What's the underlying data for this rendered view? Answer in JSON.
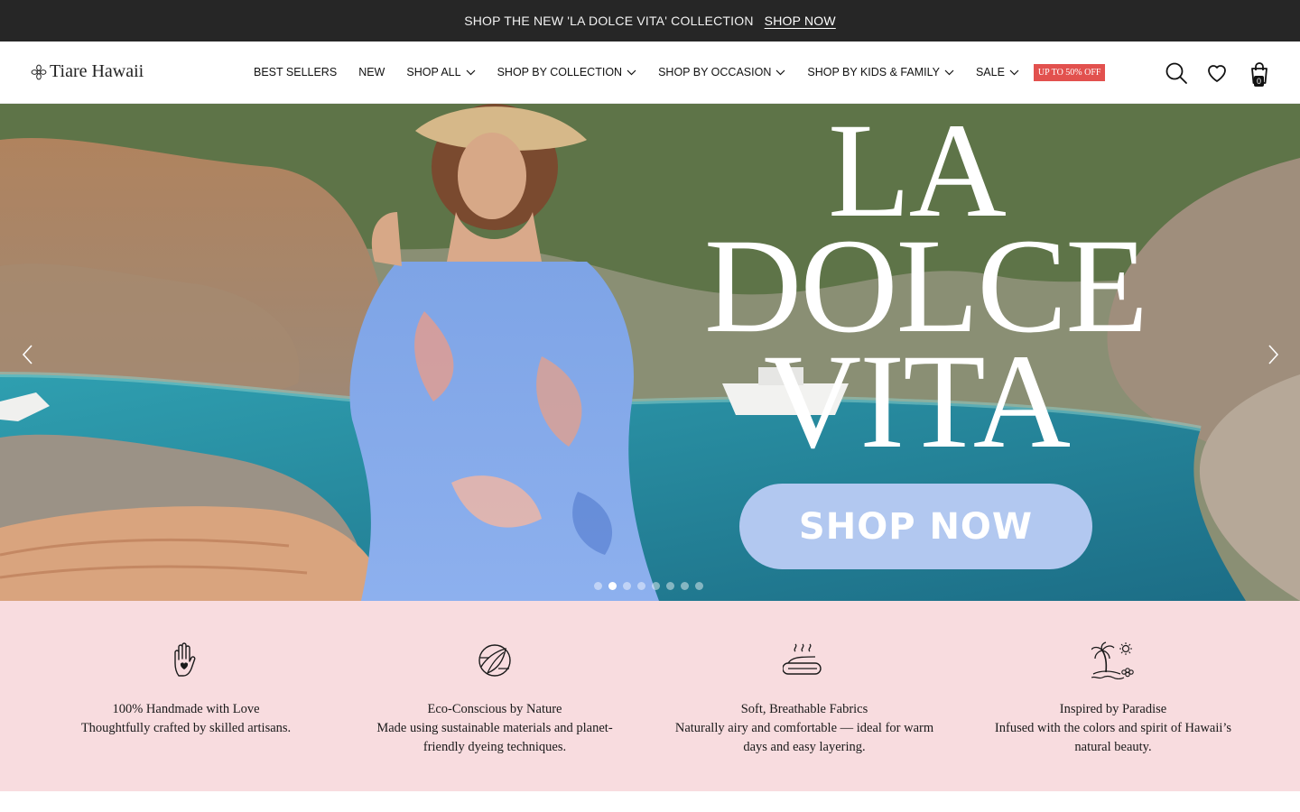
{
  "announcement": {
    "text": "SHOP THE NEW 'LA DOLCE VITA' COLLECTION",
    "link_label": "SHOP NOW"
  },
  "header": {
    "logo_text": "Tiare Hawaii",
    "logo_icon": "flower-icon",
    "nav": [
      {
        "label": "BEST SELLERS",
        "has_dropdown": false
      },
      {
        "label": "NEW",
        "has_dropdown": false
      },
      {
        "label": "SHOP ALL",
        "has_dropdown": true
      },
      {
        "label": "SHOP BY COLLECTION",
        "has_dropdown": true
      },
      {
        "label": "SHOP BY OCCASION",
        "has_dropdown": true
      },
      {
        "label": "SHOP BY KIDS & FAMILY",
        "has_dropdown": true
      },
      {
        "label": "SALE",
        "has_dropdown": true
      }
    ],
    "sale_badge": "UP TO 50% OFF",
    "icons": [
      "search-icon",
      "heart-icon",
      "shopping-bag-icon"
    ],
    "cart_count": "0"
  },
  "hero": {
    "title_lines": [
      "LA",
      "DOLCE",
      "VITA"
    ],
    "cta_label": "SHOP NOW",
    "slide_count": 8,
    "active_slide": 2,
    "arrows": [
      "chevron-left-icon",
      "chevron-right-icon"
    ]
  },
  "features": [
    {
      "icon": "hand-heart-icon",
      "title": "100% Handmade with Love",
      "description": "Thoughtfully crafted by skilled artisans."
    },
    {
      "icon": "leaf-globe-icon",
      "title": "Eco-Conscious by Nature",
      "description": "Made using sustainable materials and  planet-friendly dyeing techniques."
    },
    {
      "icon": "folded-fabric-icon",
      "title": "Soft, Breathable Fabrics",
      "description": "Naturally airy and comfortable — ideal for warm days and easy layering."
    },
    {
      "icon": "island-palm-icon",
      "title": "Inspired by Paradise",
      "description": "Infused with the colors and spirit of  Hawaii’s natural beauty."
    }
  ],
  "colors": {
    "announcement_bg": "#262626",
    "sale_badge": "#e2514e",
    "cta_bg": "#b2c8f0",
    "features_bg": "#f8dcdf"
  }
}
